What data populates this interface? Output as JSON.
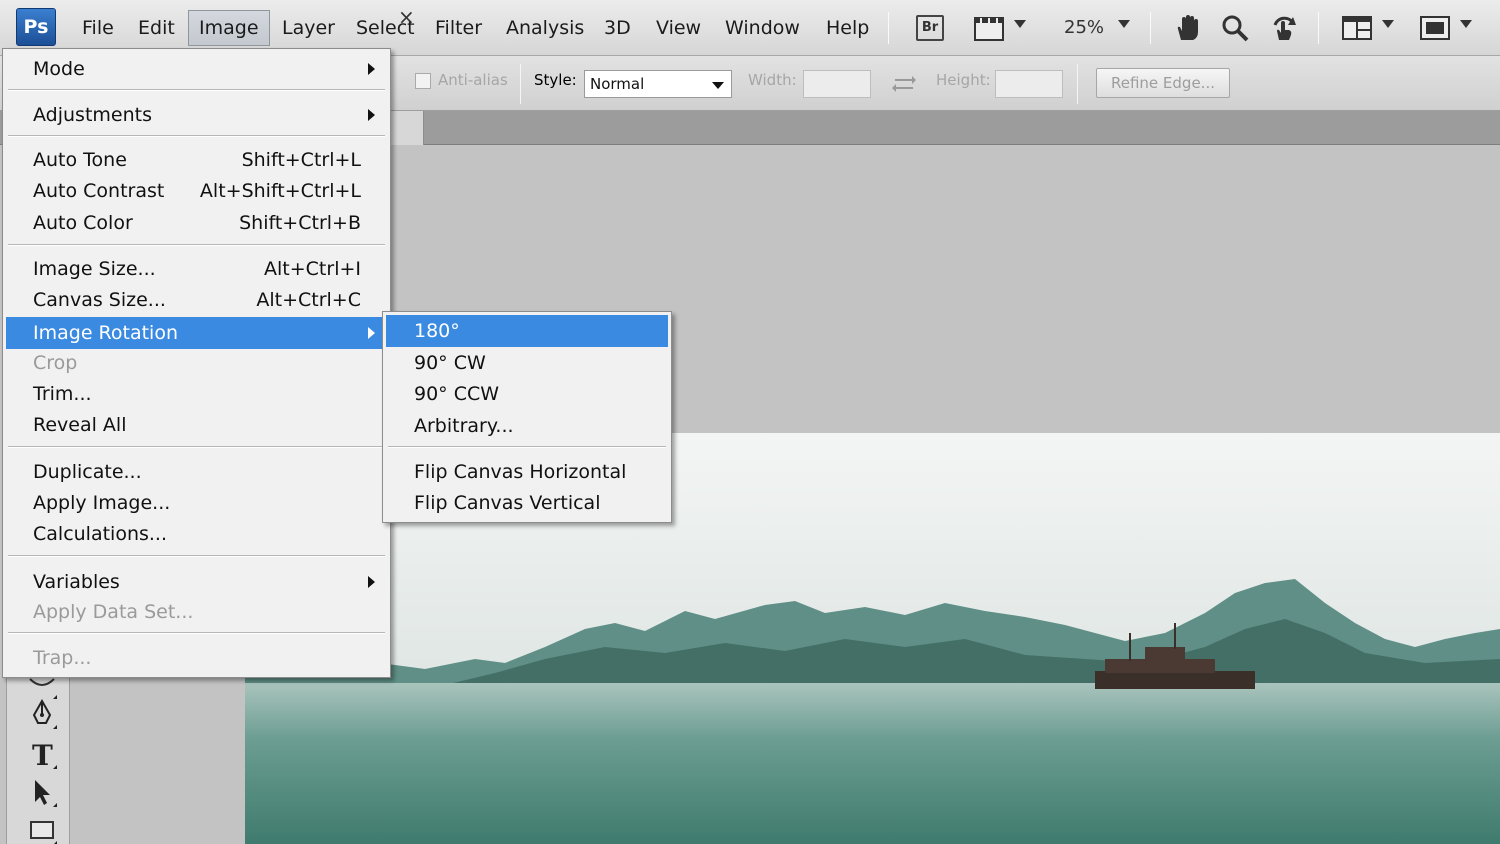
{
  "app": {
    "logo_text": "Ps"
  },
  "menubar": {
    "items": [
      "File",
      "Edit",
      "Image",
      "Layer",
      "Select",
      "Filter",
      "Analysis",
      "3D",
      "View",
      "Window",
      "Help"
    ],
    "active": "Image",
    "bridge_label": "Br",
    "zoom": "25%"
  },
  "options_bar": {
    "anti_alias_label": "Anti-alias",
    "style_label": "Style:",
    "style_value": "Normal",
    "width_label": "Width:",
    "height_label": "Height:",
    "refine_edge_label": "Refine Edge..."
  },
  "document_tab": {
    "close_glyph": "×"
  },
  "image_menu": {
    "items": [
      {
        "label": "Mode",
        "submenu": true
      },
      {
        "label": "Adjustments",
        "submenu": true
      },
      {
        "label": "Auto Tone",
        "shortcut": "Shift+Ctrl+L"
      },
      {
        "label": "Auto Contrast",
        "shortcut": "Alt+Shift+Ctrl+L"
      },
      {
        "label": "Auto Color",
        "shortcut": "Shift+Ctrl+B"
      },
      {
        "label": "Image Size...",
        "shortcut": "Alt+Ctrl+I"
      },
      {
        "label": "Canvas Size...",
        "shortcut": "Alt+Ctrl+C"
      },
      {
        "label": "Image Rotation",
        "submenu": true,
        "highlighted": true
      },
      {
        "label": "Crop",
        "disabled": true
      },
      {
        "label": "Trim..."
      },
      {
        "label": "Reveal All"
      },
      {
        "label": "Duplicate..."
      },
      {
        "label": "Apply Image..."
      },
      {
        "label": "Calculations..."
      },
      {
        "label": "Variables",
        "submenu": true
      },
      {
        "label": "Apply Data Set...",
        "disabled": true
      },
      {
        "label": "Trap...",
        "disabled": true
      }
    ]
  },
  "rotation_submenu": {
    "items": [
      {
        "label": "180°",
        "highlighted": true
      },
      {
        "label": "90° CW"
      },
      {
        "label": "90° CCW"
      },
      {
        "label": "Arbitrary..."
      },
      {
        "label": "Flip Canvas Horizontal"
      },
      {
        "label": "Flip Canvas Vertical"
      }
    ]
  },
  "colors": {
    "highlight": "#3a8ae2",
    "menu_bg": "#f1f1f1",
    "workspace": "#c3c3c3"
  }
}
